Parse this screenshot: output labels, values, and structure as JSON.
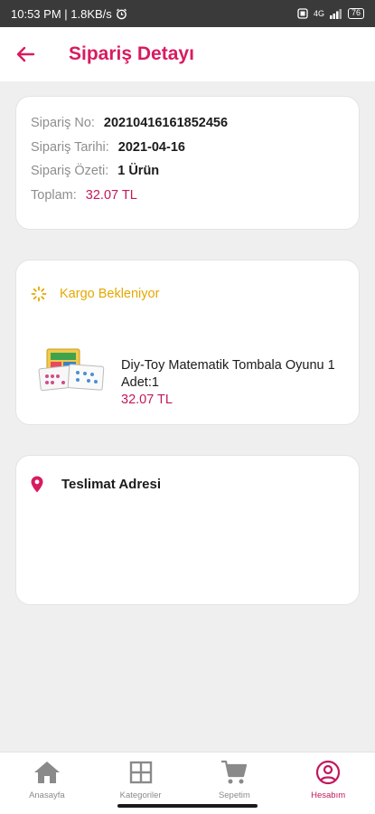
{
  "status_bar": {
    "time": "10:53 PM | 1.8KB/s",
    "network": "4G",
    "battery": "76"
  },
  "header": {
    "title": "Sipariş Detayı",
    "back_icon": "arrow-left-icon"
  },
  "order_summary": {
    "order_no_label": "Sipariş No:",
    "order_no": "20210416161852456",
    "order_date_label": "Sipariş Tarihi:",
    "order_date": "2021-04-16",
    "order_overview_label": "Sipariş Özeti:",
    "order_overview": "1 Ürün",
    "total_label": "Toplam:",
    "total": "32.07 TL"
  },
  "shipment": {
    "status_icon": "loading-spinner-icon",
    "status_text": "Kargo Bekleniyor",
    "product": {
      "name": "Diy-Toy Matematik Tombala Oyunu 1",
      "quantity": "Adet:1",
      "price": "32.07 TL"
    }
  },
  "address": {
    "icon": "location-pin-icon",
    "title": "Teslimat Adresi"
  },
  "bottom_nav": {
    "items": [
      {
        "label": "Anasayfa",
        "icon": "home-icon"
      },
      {
        "label": "Kategoriler",
        "icon": "grid-icon"
      },
      {
        "label": "Sepetim",
        "icon": "cart-icon"
      },
      {
        "label": "Hesabım",
        "icon": "account-icon"
      }
    ],
    "active_index": 3
  },
  "colors": {
    "accent": "#d81b60",
    "price": "#c2185b",
    "status_pending": "#e5a800"
  }
}
